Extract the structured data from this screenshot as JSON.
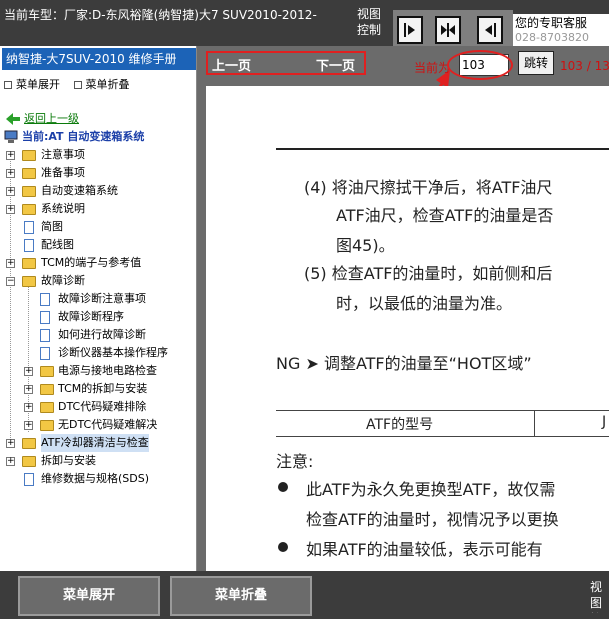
{
  "top": {
    "vehicle_title": "当前车型：厂家:D-东风裕隆(纳智捷)大7 SUV2010-2012-",
    "view_control": "视图控制",
    "contact_text": "您的专职客服",
    "contact_phone": "028-8703820"
  },
  "sidebar": {
    "manual_title": "纳智捷-大7SUV-2010 维修手册",
    "expand_all": "菜单展开",
    "collapse_all": "菜单折叠",
    "back_link": "返回上一级",
    "current_system": "当前:AT 自动变速箱系统",
    "items": [
      {
        "label": "注意事项"
      },
      {
        "label": "准备事项"
      },
      {
        "label": "自动变速箱系统"
      },
      {
        "label": "系统说明"
      },
      {
        "label": "简图"
      },
      {
        "label": "配线图"
      },
      {
        "label": "TCM的端子与参考值"
      },
      {
        "label": "故障诊断"
      },
      {
        "label": "故障诊断注意事项"
      },
      {
        "label": "故障诊断程序"
      },
      {
        "label": "如何进行故障诊断"
      },
      {
        "label": "诊断仪器基本操作程序"
      },
      {
        "label": "电源与接地电路检查"
      },
      {
        "label": "TCM的拆卸与安装"
      },
      {
        "label": "DTC代码疑难排除"
      },
      {
        "label": "无DTC代码疑难解决"
      },
      {
        "label": "ATF冷却器清洁与检查"
      },
      {
        "label": "拆卸与安装"
      },
      {
        "label": "维修数据与规格(SDS)"
      }
    ]
  },
  "toolbar": {
    "prev_page": "上一页",
    "next_page": "下一页",
    "current_label": "当前为",
    "page_value": "103",
    "jump_button": "跳转",
    "page_count": "103 / 138"
  },
  "document": {
    "line1": "(4) 将油尺擦拭干净后，将ATF油尺",
    "line2": "ATF油尺，检查ATF的油量是否",
    "line3": "图45)。",
    "line4": "(5) 检查ATF的油量时，如前侧和后",
    "line5": "时，以最低的油量为准。",
    "ng_line": "NG  ➤ 调整ATF的油量至“HOT区域”",
    "table_header": "ATF的型号",
    "table_header2": "J",
    "note_title": "注意:",
    "bullet1a": "此ATF为永久免更换型ATF，故仅需",
    "bullet1b": "检查ATF的油量时，视情况予以更换",
    "bullet2a": "如果ATF的油量较低，表示可能有"
  },
  "bottom": {
    "expand_button": "菜单展开",
    "collapse_button": "菜单折叠",
    "view_control": "视图控制"
  },
  "colors": {
    "annotation_red": "#e02020",
    "manual_header_blue": "#1c63b7",
    "toolbar_gray": "#6b6b6b"
  }
}
